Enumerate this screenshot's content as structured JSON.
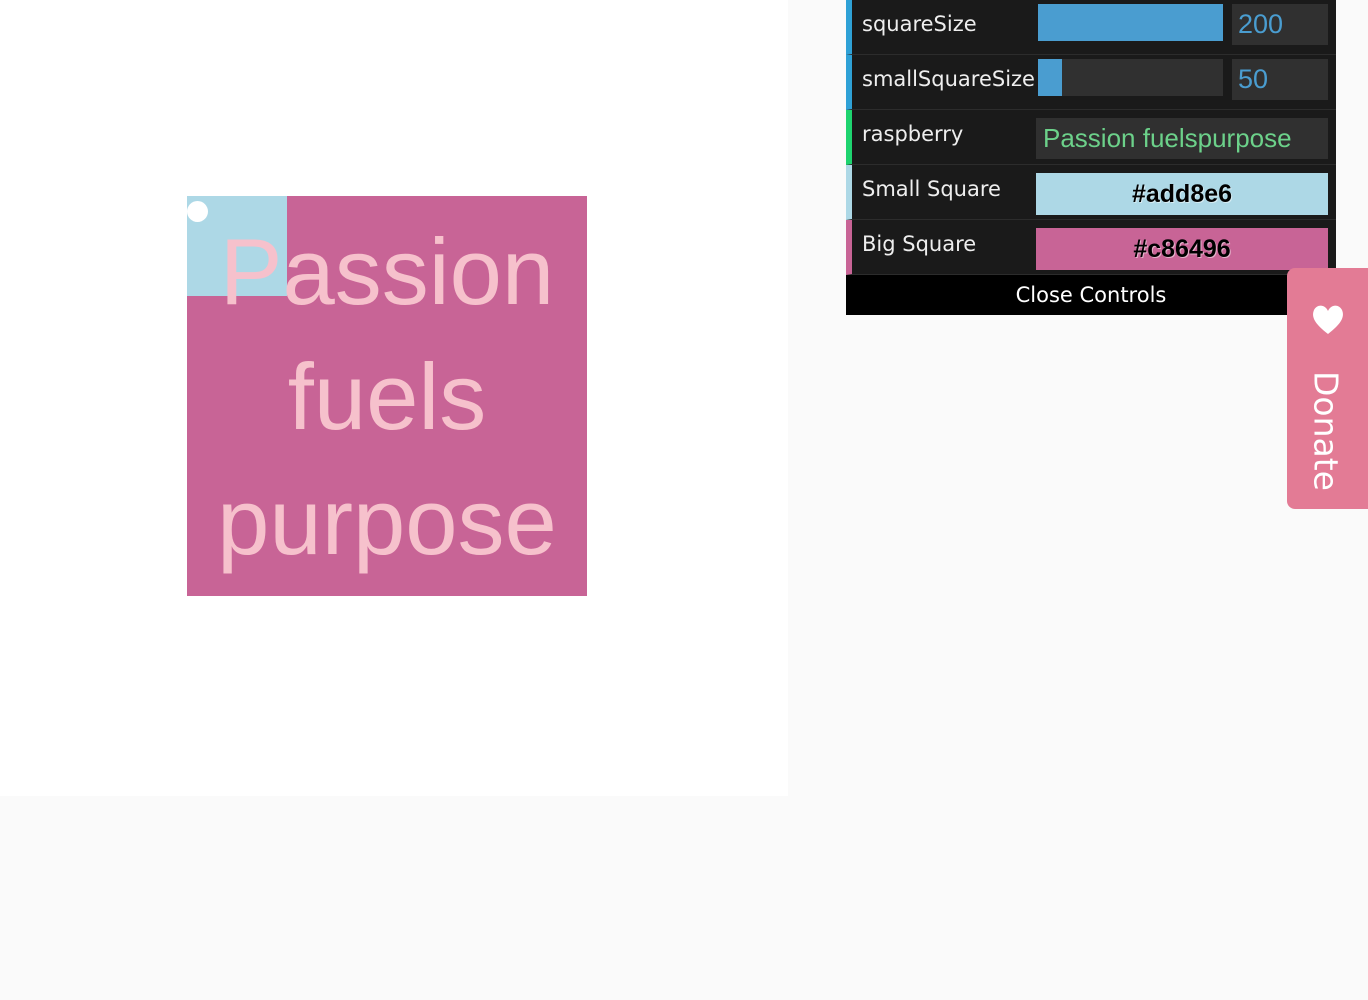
{
  "colors": {
    "small_square": "#add8e6",
    "big_square": "#c86496",
    "text": "#f6c1cc"
  },
  "canvas": {
    "text_lines": [
      "Passion",
      "fuels",
      "purpose"
    ]
  },
  "controls": {
    "square_size": {
      "label": "squareSize",
      "value": "200",
      "fill_fraction": 1.0
    },
    "small_square_size": {
      "label": "smallSquareSize",
      "value": "50",
      "fill_fraction": 0.13
    },
    "raspberry": {
      "label": "raspberry",
      "value": "Passion fuelspurpose"
    },
    "small_square": {
      "label": "Small Square",
      "value": "#add8e6"
    },
    "big_square": {
      "label": "Big Square",
      "value": "#c86496"
    },
    "close_label": "Close Controls"
  },
  "donate": {
    "label": "Donate",
    "icon": "heart-icon"
  }
}
